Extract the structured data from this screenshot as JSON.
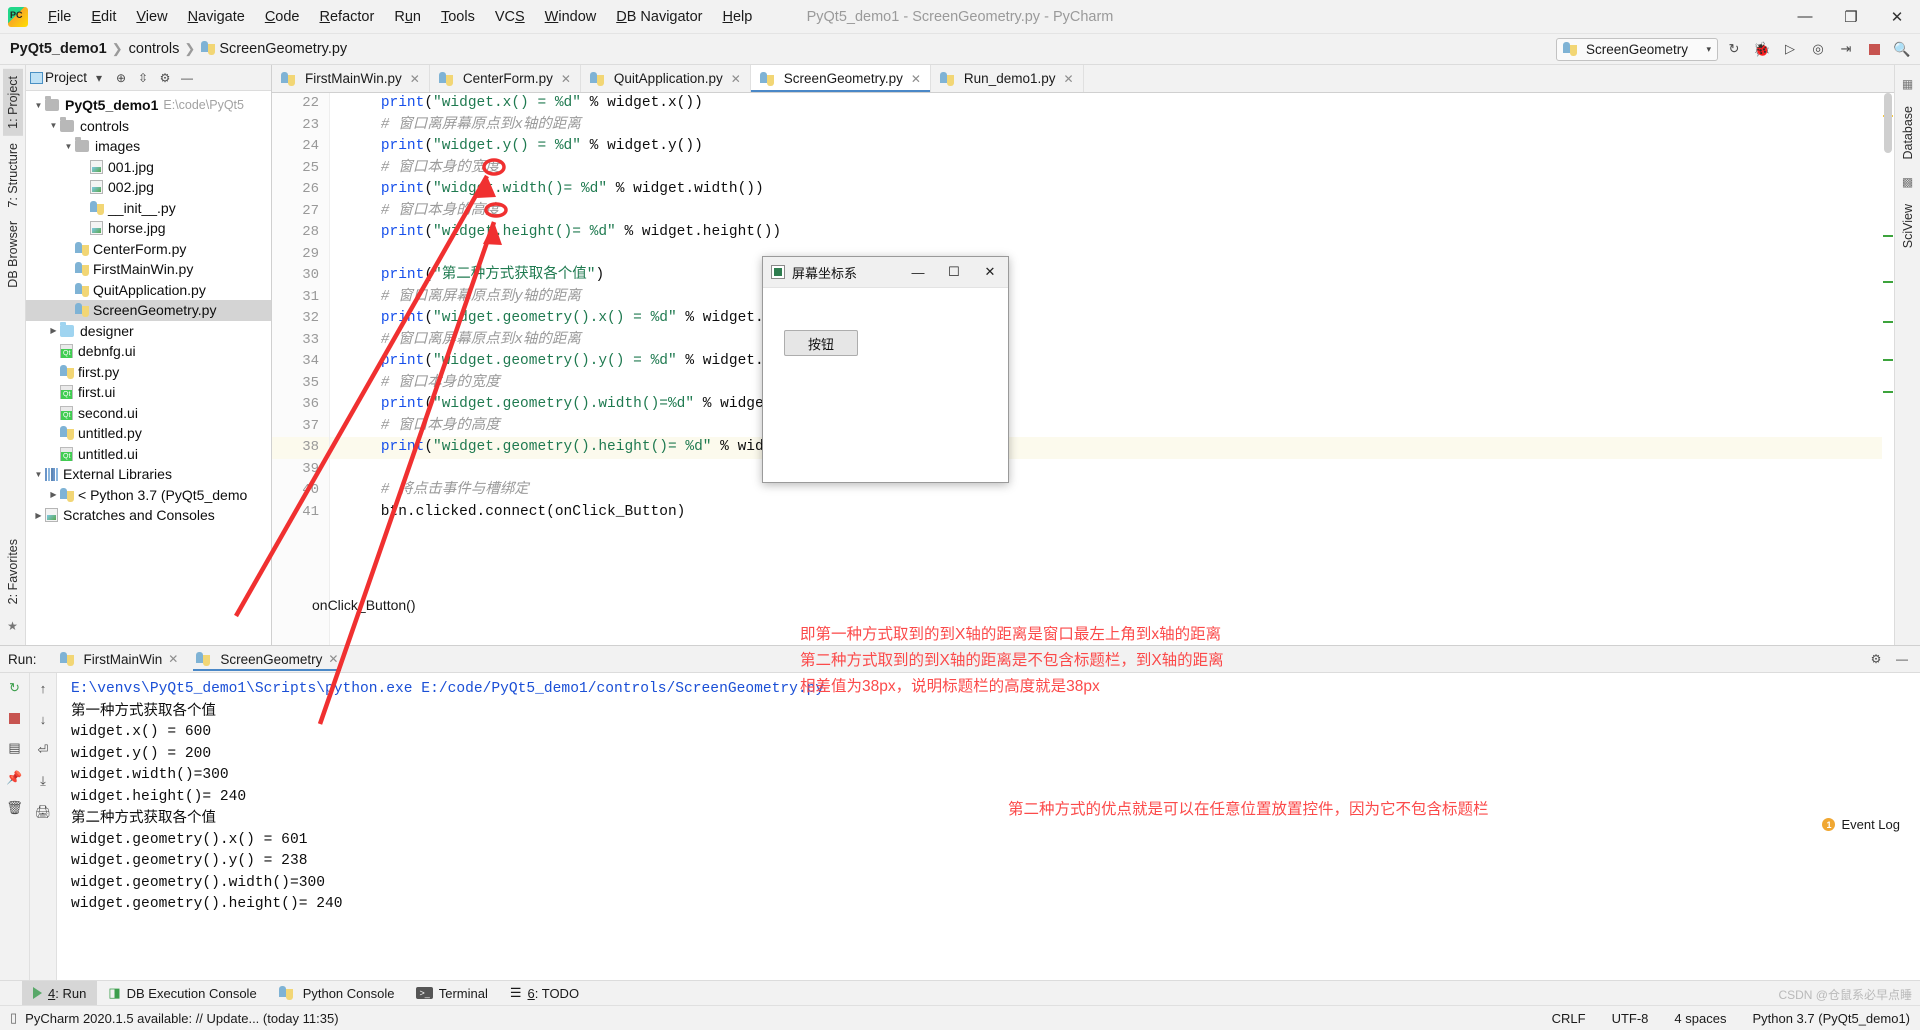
{
  "window": {
    "title": "PyQt5_demo1 - ScreenGeometry.py - PyCharm",
    "minimize": "—",
    "maximize": "❐",
    "close": "✕"
  },
  "menubar": {
    "items": [
      "File",
      "Edit",
      "View",
      "Navigate",
      "Code",
      "Refactor",
      "Run",
      "Tools",
      "VCS",
      "Window",
      "DB Navigator",
      "Help"
    ]
  },
  "breadcrumb": {
    "project": "PyQt5_demo1",
    "folder": "controls",
    "file": "ScreenGeometry.py"
  },
  "toolbar": {
    "run_config": "ScreenGeometry",
    "caret": "▾",
    "buttons": [
      "rerun-icon",
      "debug-icon",
      "coverage-icon",
      "profile-icon",
      "attach-icon",
      "stop-icon",
      "search-icon"
    ]
  },
  "left_strip": {
    "tabs": [
      "1: Project",
      "7: Structure",
      "DB Browser",
      "2: Favorites"
    ]
  },
  "right_strip": {
    "tabs": [
      "Database",
      "SciView"
    ]
  },
  "project_panel": {
    "title": "Project",
    "tree": [
      {
        "depth": 0,
        "arrow": "▼",
        "icon": "folder",
        "label": "PyQt5_demo1",
        "bold": true,
        "hint": "E:\\code\\PyQt5"
      },
      {
        "depth": 1,
        "arrow": "▼",
        "icon": "folder",
        "label": "controls",
        "bold": false,
        "hint": ""
      },
      {
        "depth": 2,
        "arrow": "▼",
        "icon": "folder",
        "label": "images",
        "bold": false,
        "hint": ""
      },
      {
        "depth": 3,
        "arrow": "",
        "icon": "img",
        "label": "001.jpg",
        "bold": false,
        "hint": ""
      },
      {
        "depth": 3,
        "arrow": "",
        "icon": "img",
        "label": "002.jpg",
        "bold": false,
        "hint": ""
      },
      {
        "depth": 3,
        "arrow": "",
        "icon": "py",
        "label": "__init__.py",
        "bold": false,
        "hint": ""
      },
      {
        "depth": 3,
        "arrow": "",
        "icon": "img",
        "label": "horse.jpg",
        "bold": false,
        "hint": ""
      },
      {
        "depth": 2,
        "arrow": "",
        "icon": "py",
        "label": "CenterForm.py",
        "bold": false,
        "hint": ""
      },
      {
        "depth": 2,
        "arrow": "",
        "icon": "py",
        "label": "FirstMainWin.py",
        "bold": false,
        "hint": ""
      },
      {
        "depth": 2,
        "arrow": "",
        "icon": "py",
        "label": "QuitApplication.py",
        "bold": false,
        "hint": ""
      },
      {
        "depth": 2,
        "arrow": "",
        "icon": "py",
        "label": "ScreenGeometry.py",
        "bold": false,
        "hint": "",
        "selected": true
      },
      {
        "depth": 1,
        "arrow": "▶",
        "icon": "folder-blue",
        "label": "designer",
        "bold": false,
        "hint": ""
      },
      {
        "depth": 1,
        "arrow": "",
        "icon": "qt",
        "label": "debnfg.ui",
        "bold": false,
        "hint": ""
      },
      {
        "depth": 1,
        "arrow": "",
        "icon": "py",
        "label": "first.py",
        "bold": false,
        "hint": ""
      },
      {
        "depth": 1,
        "arrow": "",
        "icon": "qt",
        "label": "first.ui",
        "bold": false,
        "hint": ""
      },
      {
        "depth": 1,
        "arrow": "",
        "icon": "qt",
        "label": "second.ui",
        "bold": false,
        "hint": ""
      },
      {
        "depth": 1,
        "arrow": "",
        "icon": "py",
        "label": "untitled.py",
        "bold": false,
        "hint": ""
      },
      {
        "depth": 1,
        "arrow": "",
        "icon": "qt",
        "label": "untitled.ui",
        "bold": false,
        "hint": ""
      },
      {
        "depth": 0,
        "arrow": "▼",
        "icon": "ext",
        "label": "External Libraries",
        "bold": false,
        "hint": ""
      },
      {
        "depth": 1,
        "arrow": "▶",
        "icon": "py",
        "label": "< Python 3.7 (PyQt5_demo",
        "bold": false,
        "hint": ""
      },
      {
        "depth": 0,
        "arrow": "▶",
        "icon": "scratch",
        "label": "Scratches and Consoles",
        "bold": false,
        "hint": ""
      }
    ]
  },
  "editor": {
    "tabs": [
      {
        "label": "FirstMainWin.py",
        "active": false
      },
      {
        "label": "CenterForm.py",
        "active": false
      },
      {
        "label": "QuitApplication.py",
        "active": false
      },
      {
        "label": "ScreenGeometry.py",
        "active": true
      },
      {
        "label": "Run_demo1.py",
        "active": false
      }
    ],
    "lines": [
      {
        "no": "22",
        "text": "    print(\"widget.x() = %d\" % widget.x())",
        "hl": false
      },
      {
        "no": "23",
        "text": "    # 窗口离屏幕原点到x轴的距离",
        "hl": false
      },
      {
        "no": "24",
        "text": "    print(\"widget.y() = %d\" % widget.y())",
        "hl": false
      },
      {
        "no": "25",
        "text": "    # 窗口本身的宽度",
        "hl": false
      },
      {
        "no": "26",
        "text": "    print(\"widget.width()= %d\" % widget.width())",
        "hl": false
      },
      {
        "no": "27",
        "text": "    # 窗口本身的高度",
        "hl": false
      },
      {
        "no": "28",
        "text": "    print(\"widget.height()= %d\" % widget.height())",
        "hl": false
      },
      {
        "no": "29",
        "text": "",
        "hl": false
      },
      {
        "no": "30",
        "text": "    print(\"第二种方式获取各个值\")",
        "hl": false
      },
      {
        "no": "31",
        "text": "    # 窗口离屏幕原点到y轴的距离",
        "hl": false
      },
      {
        "no": "32",
        "text": "    print(\"widget.geometry().x() = %d\" % widget.geometry().x())",
        "hl": false
      },
      {
        "no": "33",
        "text": "    # 窗口离屏幕原点到x轴的距离",
        "hl": false
      },
      {
        "no": "34",
        "text": "    print(\"widget.geometry().y() = %d\" % widget.geometry().y())",
        "hl": false
      },
      {
        "no": "35",
        "text": "    # 窗口本身的宽度",
        "hl": false
      },
      {
        "no": "36",
        "text": "    print(\"widget.geometry().width()=%d\" % widget.geometry().width())",
        "hl": false
      },
      {
        "no": "37",
        "text": "    # 窗口本身的高度",
        "hl": false
      },
      {
        "no": "38",
        "text": "    print(\"widget.geometry().height()= %d\" % widget.geometry().height())",
        "hl": true
      },
      {
        "no": "39",
        "text": "",
        "hl": false
      },
      {
        "no": "40",
        "text": "    # 将点击事件与槽绑定",
        "hl": false
      },
      {
        "no": "41",
        "text": "    btn.clicked.connect(onClick_Button)",
        "hl": false
      }
    ]
  },
  "qt_popup": {
    "title": "屏幕坐标系",
    "minimize": "—",
    "maximize": "☐",
    "close": "✕",
    "button": "按钮"
  },
  "run_panel": {
    "label": "Run:",
    "tabs": [
      {
        "label": "FirstMainWin",
        "active": false
      },
      {
        "label": "ScreenGeometry",
        "active": true
      }
    ],
    "console_lines": [
      {
        "text": "E:\\venvs\\PyQt5_demo1\\Scripts\\python.exe E:/code/PyQt5_demo1/controls/ScreenGeometry.py",
        "style": "blue"
      },
      {
        "text": "第一种方式获取各个值",
        "style": "cjk"
      },
      {
        "text": "widget.x() = 600",
        "style": ""
      },
      {
        "text": "widget.y() = 200",
        "style": ""
      },
      {
        "text": "widget.width()=300",
        "style": ""
      },
      {
        "text": "widget.height()= 240",
        "style": ""
      },
      {
        "text": "第二种方式获取各个值",
        "style": "cjk"
      },
      {
        "text": "widget.geometry().x() = 601",
        "style": ""
      },
      {
        "text": "widget.geometry().y() = 238",
        "style": ""
      },
      {
        "text": "widget.geometry().width()=300",
        "style": ""
      },
      {
        "text": "widget.geometry().height()= 240",
        "style": ""
      }
    ],
    "tooltip": "onClick_Button()"
  },
  "annotations": {
    "color": "#fb4a4a",
    "block1": [
      "即第一种方式取到的到X轴的距离是窗口最左上角到x轴的距离",
      "第二种方式取到的到X轴的距离是不包含标题栏，到X轴的距离",
      "相差值为38px，说明标题栏的高度就是38px"
    ],
    "block2": "第二种方式的优点就是可以在任意位置放置控件，因为它不包含标题栏"
  },
  "toolwindow_bar": {
    "items": [
      {
        "label": "4: Run",
        "underline": "4",
        "selected": true,
        "icon": "run-icon"
      },
      {
        "label": "DB Execution Console",
        "underline": "",
        "selected": false,
        "icon": "db-console-icon"
      },
      {
        "label": "Python Console",
        "underline": "",
        "selected": false,
        "icon": "python-icon"
      },
      {
        "label": "Terminal",
        "underline": "",
        "selected": false,
        "icon": "terminal-icon"
      },
      {
        "label": "6: TODO",
        "underline": "6",
        "selected": false,
        "icon": "todo-icon"
      }
    ]
  },
  "status_bar": {
    "message": "PyCharm 2020.1.5 available: // Update... (today 11:35)",
    "line_sep": "CRLF",
    "encoding": "UTF-8",
    "indent": "4 spaces",
    "interpreter": "Python 3.7 (PyQt5_demo1)",
    "event_log": "Event Log",
    "event_count": "1"
  },
  "watermark": "CSDN @仓鼠系必早点睡"
}
